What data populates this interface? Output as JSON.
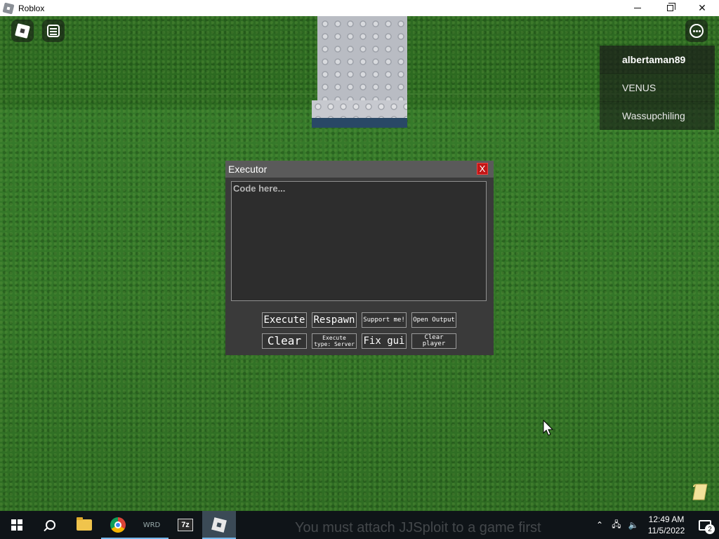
{
  "window": {
    "title": "Roblox",
    "controls": {
      "minimize": "minimize-icon",
      "maximize": "restore-icon",
      "close": "close-icon"
    }
  },
  "hud": {
    "roblox_menu_icon": "roblox-logo-icon",
    "chat_icon": "chat-icon",
    "more_icon": "more-options-icon"
  },
  "playerlist": {
    "players": [
      {
        "name": "albertaman89"
      },
      {
        "name": "VENUS"
      },
      {
        "name": "Wassupchiling"
      }
    ]
  },
  "executor": {
    "title": "Executor",
    "close_label": "X",
    "code_placeholder": "Code here...",
    "buttons": {
      "execute": "Execute",
      "respawn": "Respawn",
      "support": "Support me!",
      "open_output": "Open Output",
      "clear": "Clear",
      "execute_type_line1": "Execute",
      "execute_type_line2": "type: Server",
      "fix_gui": "Fix gui",
      "clear_player": "Clear player"
    }
  },
  "taskbar": {
    "apps": [
      "start-icon",
      "search-icon",
      "file-explorer-icon",
      "chrome-icon",
      "wrd-app-icon",
      "7zip-icon",
      "roblox-icon"
    ],
    "sevenzip_label": "7z",
    "wrd_label": "WRD",
    "marquee": "You must attach JJSploit to a game first",
    "clock_time": "12:49 AM",
    "clock_date": "11/5/2022",
    "notification_count": "2"
  },
  "colors": {
    "grass": "#347628",
    "executor_bg": "#3a3a3a",
    "executor_header": "#5a5a5a",
    "close_red": "#c41616",
    "taskbar": "#0f1418"
  }
}
